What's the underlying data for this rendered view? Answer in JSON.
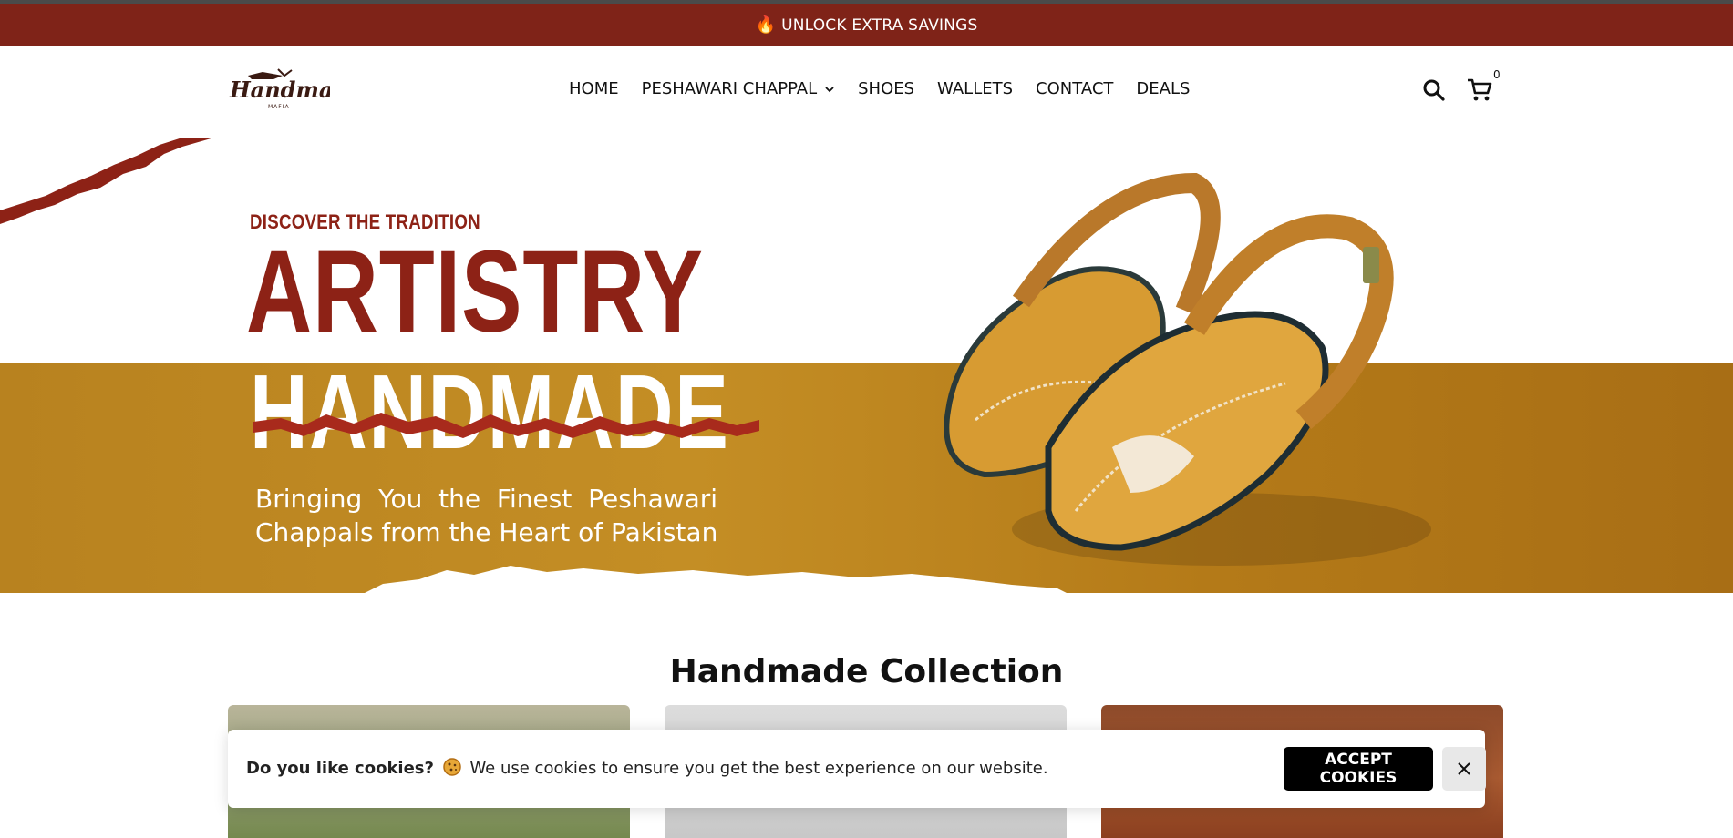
{
  "announcement": {
    "icon": "fire-icon",
    "text": "UNLOCK EXTRA SAVINGS"
  },
  "header": {
    "logo_alt": "Handmade",
    "nav": [
      {
        "label": "HOME"
      },
      {
        "label": "PESHAWARI CHAPPAL",
        "has_dropdown": true
      },
      {
        "label": "SHOES"
      },
      {
        "label": "WALLETS"
      },
      {
        "label": "CONTACT"
      },
      {
        "label": "DEALS"
      }
    ],
    "cart_count": "0"
  },
  "hero": {
    "eyebrow": "DISCOVER THE TRADITION",
    "title_line1": "ARTISTRY",
    "title_line2": "HANDMADE",
    "subtitle_line1": "Bringing  You  the  Finest  Peshawari",
    "subtitle_line2": "Chappals from the Heart of Pakistan"
  },
  "collection": {
    "title": "Handmade Collection"
  },
  "cookie_banner": {
    "question": "Do you like cookies?",
    "message": "We use cookies to ensure you get the best experience on our website.",
    "accept_label": "ACCEPT COOKIES"
  },
  "colors": {
    "brand_red": "#7f2318",
    "mustard": "#b8821f",
    "black": "#000000"
  }
}
